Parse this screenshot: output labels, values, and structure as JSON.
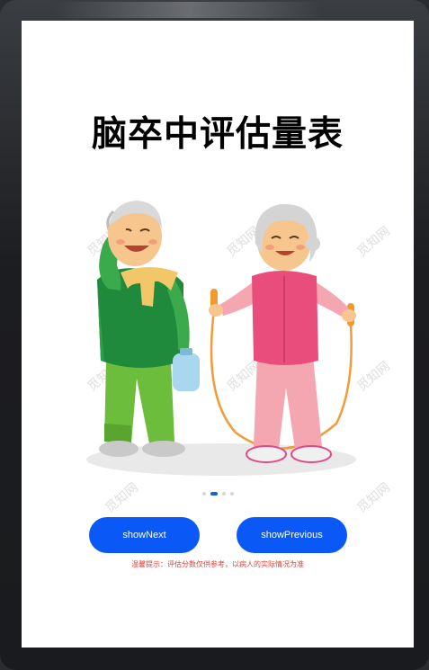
{
  "page": {
    "title": "脑卒中评估量表",
    "tip": "温馨提示：评估分数仅供参考，以病人的实际情况为准"
  },
  "illustration": {
    "description_icon": "elderly-couple-illustration",
    "watermark": "觅知网"
  },
  "pager": {
    "count": 4,
    "active_index": 1,
    "active_color": "#1a5fd6"
  },
  "buttons": {
    "next_label": "showNext",
    "previous_label": "showPrevious",
    "color": "#0a59f7"
  }
}
